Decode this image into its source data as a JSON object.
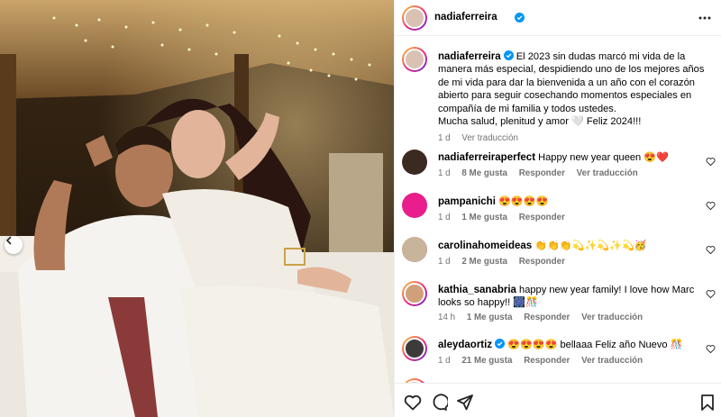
{
  "post": {
    "author": "nadiaferreira",
    "more_icon": "more-horizontal-icon",
    "caption": {
      "text": "El 2023 sin dudas marcó mi vida de la manera más especial, despidiendo uno de los mejores años de mi vida para dar la bienvenida a un año con el corazón abierto para seguir cosechando momentos especiales en compañía de mi familia y todos ustedes.",
      "text2": "Mucha salud, plenitud y amor 🤍 Feliz 2024!!!",
      "time": "1 d",
      "translate": "Ver traducción"
    }
  },
  "comments": [
    {
      "user": "nadiaferreiraperfect",
      "text": "Happy new year queen 😍❤️",
      "time": "1 d",
      "likes": "8 Me gusta",
      "reply": "Responder",
      "translate": "Ver traducción",
      "verified": false
    },
    {
      "user": "pampanichi",
      "text": "😍😍😍😍",
      "time": "1 d",
      "likes": "1 Me gusta",
      "reply": "Responder",
      "translate": "",
      "verified": false
    },
    {
      "user": "carolinahomeideas",
      "text": "👏👏👏💫✨💫✨💫🥳",
      "time": "1 d",
      "likes": "2 Me gusta",
      "reply": "Responder",
      "translate": "",
      "verified": false
    },
    {
      "user": "kathia_sanabria",
      "text": "happy new year family! I love how Marc looks so happy!! 🎆🎊",
      "time": "14 h",
      "likes": "1 Me gusta",
      "reply": "Responder",
      "translate": "Ver traducción",
      "verified": false
    },
    {
      "user": "aleydaortiz",
      "text": "😍😍😍😍 bellaaa Feliz año Nuevo 🎊",
      "time": "1 d",
      "likes": "21 Me gusta",
      "reply": "Responder",
      "translate": "Ver traducción",
      "verified": true
    }
  ],
  "actions": {
    "like_icon": "heart-icon",
    "comment_icon": "comment-icon",
    "share_icon": "paper-plane-icon",
    "save_icon": "bookmark-icon"
  },
  "colors": {
    "verified": "#0095f6",
    "muted": "#737373",
    "divider": "#efefef"
  }
}
